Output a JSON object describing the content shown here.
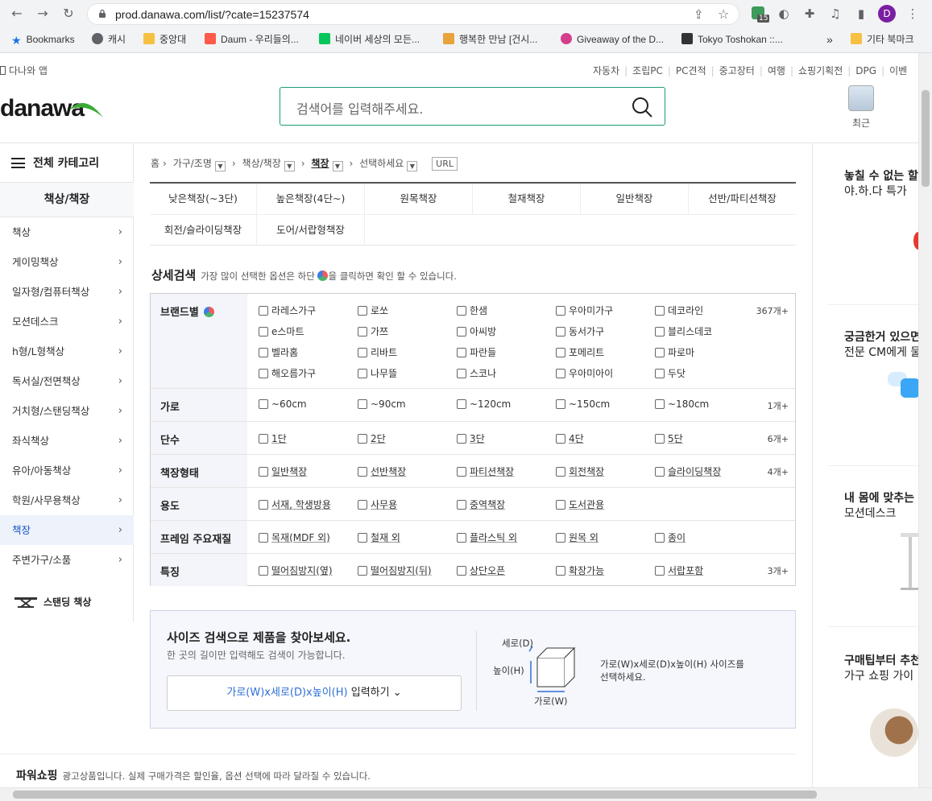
{
  "browser": {
    "url": "prod.danawa.com/list/?cate=15237574",
    "bookmarks": [
      {
        "label": "Bookmarks",
        "color": "#1a73e8"
      },
      {
        "label": "캐시",
        "color": "#5f6368"
      },
      {
        "label": "중앙대",
        "color": "#f6c142"
      },
      {
        "label": "Daum - 우리들의...",
        "color": "#ff5a4a"
      },
      {
        "label": "네이버 세상의 모든...",
        "color": "#03c75a"
      },
      {
        "label": "행복한 만남 [건시...",
        "color": "#e8a33b"
      },
      {
        "label": "Giveaway of the D...",
        "color": "#d43f8d"
      },
      {
        "label": "Tokyo Toshokan ::...",
        "color": "#333333"
      }
    ],
    "more": "»",
    "other_bookmarks": "기타 북마크",
    "ext_badge": "15",
    "profile_initial": "D"
  },
  "util": {
    "app": "다나와 앱",
    "links": [
      "자동차",
      "조립PC",
      "PC견적",
      "중고장터",
      "여행",
      "쇼핑기획전",
      "DPG",
      "이벤"
    ]
  },
  "header": {
    "logo": "danawa",
    "search_placeholder": "검색어를 입력해주세요.",
    "recent": "최근"
  },
  "sidebar": {
    "all_categories": "전체 카테고리",
    "current": "책상/책장",
    "items": [
      {
        "label": "책상",
        "active": false
      },
      {
        "label": "게이밍책상",
        "active": false
      },
      {
        "label": "일자형/컴퓨터책상",
        "active": false
      },
      {
        "label": "모션데스크",
        "active": false
      },
      {
        "label": "h형/L형책상",
        "active": false
      },
      {
        "label": "독서실/전면책상",
        "active": false
      },
      {
        "label": "거치형/스탠딩책상",
        "active": false
      },
      {
        "label": "좌식책상",
        "active": false
      },
      {
        "label": "유아/아동책상",
        "active": false
      },
      {
        "label": "학원/사무용책상",
        "active": false
      },
      {
        "label": "책장",
        "active": true
      },
      {
        "label": "주변가구/소품",
        "active": false
      }
    ],
    "standing": "스탠딩 책상"
  },
  "breadcrumb": {
    "home": "홈",
    "l1": "가구/조명",
    "l2": "책상/책장",
    "l3": "책장",
    "l4": "선택하세요",
    "url_btn": "URL"
  },
  "subcats": {
    "row1": [
      "낮은책장(~3단)",
      "높은책장(4단~)",
      "원목책장",
      "철재책장",
      "일반책장",
      "선반/파티션책장"
    ],
    "row2": [
      "회전/슬라이딩책장",
      "도어/서랍형책장"
    ]
  },
  "detail": {
    "title": "상세검색",
    "desc_pre": "가장 많이 선택한 옵션은 하단",
    "desc_post": "을 클릭하면 확인 할 수 있습니다."
  },
  "filters": [
    {
      "label": "브랜드별",
      "dot": true,
      "count": "367개+",
      "underline": false,
      "options": [
        "라레스가구",
        "로쏘",
        "한샘",
        "우아미가구",
        "데코라인",
        "e스마트",
        "가쯔",
        "아씨방",
        "동서가구",
        "블리스데코",
        "벨라홈",
        "리바트",
        "파란들",
        "포메리트",
        "파로마",
        "해오름가구",
        "나무뜰",
        "스코나",
        "우아미아이",
        "두닷"
      ]
    },
    {
      "label": "가로",
      "dot": false,
      "count": "1개+",
      "underline": false,
      "options": [
        "~60cm",
        "~90cm",
        "~120cm",
        "~150cm",
        "~180cm"
      ]
    },
    {
      "label": "단수",
      "dot": false,
      "count": "6개+",
      "underline": true,
      "options": [
        "1단",
        "2단",
        "3단",
        "4단",
        "5단"
      ]
    },
    {
      "label": "책장형태",
      "dot": false,
      "count": "4개+",
      "underline": true,
      "options": [
        "일반책장",
        "선반책장",
        "파티션책장",
        "회전책장",
        "슬라이딩책장"
      ]
    },
    {
      "label": "용도",
      "dot": false,
      "count": "",
      "underline": true,
      "options": [
        "서재, 학생방용",
        "사무용",
        "중역책장",
        "도서관용"
      ]
    },
    {
      "label": "프레임 주요재질",
      "dot": false,
      "count": "",
      "underline": true,
      "options": [
        "목재(MDF 외)",
        "철재 외",
        "플라스틱 외",
        "원목 외",
        "종이"
      ]
    },
    {
      "label": "특징",
      "dot": false,
      "count": "3개+",
      "underline": true,
      "options": [
        "떨어짐방지(옆)",
        "떨어짐방지(뒤)",
        "상단오픈",
        "확장가능",
        "서랍포함"
      ]
    }
  ],
  "size_search": {
    "title": "사이즈 검색으로 제품을 찾아보세요.",
    "desc": "한 곳의 길이만 입력해도 검색이 가능합니다.",
    "btn_dims": "가로(W)x세로(D)x높이(H)",
    "btn_action": "입력하기",
    "dim_d": "세로(D)",
    "dim_h": "높이(H)",
    "dim_w": "가로(W)",
    "hint1": "가로(W)x세로(D)x높이(H) 사이즈를",
    "hint2": "선택하세요."
  },
  "power": {
    "title": "파워쇼핑",
    "desc": "광고상품입니다. 실제 구매가격은 할인율, 옵션 선택에 따라 달라질 수 있습니다."
  },
  "right": [
    {
      "line1": "놓칠 수 없는 할",
      "line2": "야.하.다 특가"
    },
    {
      "line1": "궁금한거 있으면",
      "line2": "전문 CM에게 물"
    },
    {
      "line1": "내 몸에 맞추는",
      "line2": "모션데스크"
    },
    {
      "line1": "구매팁부터 추천",
      "line2": "가구 쇼핑 가이"
    }
  ]
}
